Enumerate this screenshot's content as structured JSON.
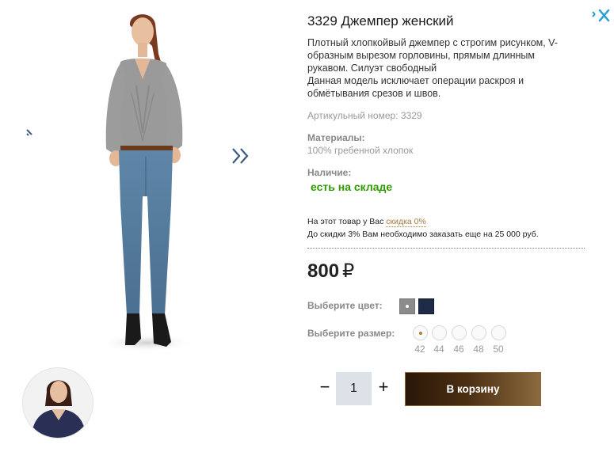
{
  "product": {
    "title": "3329 Джемпер женский",
    "description_lines": [
      "Плотный хлопкойвый джемпер с строгим рисунком, V-образным вырезом горловины, прямым длинным рукавом. Силуэт свободный",
      "Данная модель исключает операции раскроя и обмётывания срезов и швов."
    ],
    "sku": "Артикульный номер: 3329",
    "materials_label": "Материалы:",
    "materials_value": "100% гребенной хлопок",
    "availability_label": "Наличие:",
    "availability_value": "есть на складе",
    "availability_color": "#2f9b00"
  },
  "discount": {
    "prefix": "На этот товар у Вас ",
    "link": "скидка 0%",
    "note": "До скидки 3% Вам необходимо заказать еще на 25 000 руб."
  },
  "price": {
    "value": "800",
    "currency": "₽"
  },
  "color": {
    "label": "Выберите цвет:",
    "options": [
      {
        "name": "grey",
        "hex": "#8b8b8b",
        "selected": true
      },
      {
        "name": "navy",
        "hex": "#1f2a46",
        "selected": false
      }
    ]
  },
  "size": {
    "label": "Выберите размер:",
    "options": [
      "42",
      "44",
      "46",
      "48",
      "50"
    ],
    "selected": "42"
  },
  "quantity": {
    "minus": "−",
    "value": "1",
    "plus": "+"
  },
  "cart_button": "В корзину",
  "icons": {
    "close": "close-icon",
    "prev": "chevron-left-icon",
    "next": "double-chevron-right-icon"
  },
  "colors": {
    "accent_link": "#a57a3a",
    "close_blue": "#2a9fd6",
    "button_dark": "#2a1708",
    "button_light": "#8b6a3e"
  }
}
